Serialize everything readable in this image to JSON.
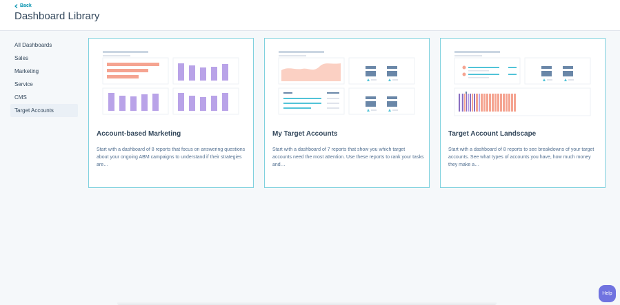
{
  "header": {
    "back_label": "Back",
    "title": "Dashboard Library"
  },
  "sidebar": {
    "items": [
      {
        "label": "All Dashboards"
      },
      {
        "label": "Sales"
      },
      {
        "label": "Marketing"
      },
      {
        "label": "Service"
      },
      {
        "label": "CMS"
      },
      {
        "label": "Target Accounts",
        "active": true
      }
    ]
  },
  "cards": [
    {
      "title": "Account-based Marketing",
      "description": "Start with a dashboard of 8 reports that focus on answering questions about your ongoing ABM campaigns to understand if their strategies are…"
    },
    {
      "title": "My Target Accounts",
      "description": "Start with a dashboard of 7 reports that show you which target accounts need the most attention. Use these reports to rank your tasks and…"
    },
    {
      "title": "Target Account Landscape",
      "description": "Start with a dashboard of 8 reports to see breakdowns of your target accounts. See what types of accounts you have, how much money they make a…"
    }
  ],
  "help_label": "Help",
  "colors": {
    "accent": "#0091ae",
    "card_border": "#7fd1de",
    "purple": "#b9a3e8",
    "salmon": "#f5a491",
    "teal": "#51c3d8",
    "slate": "#6a87a8",
    "help": "#7073e0"
  },
  "icons": {
    "back": "chevron-left-icon"
  }
}
